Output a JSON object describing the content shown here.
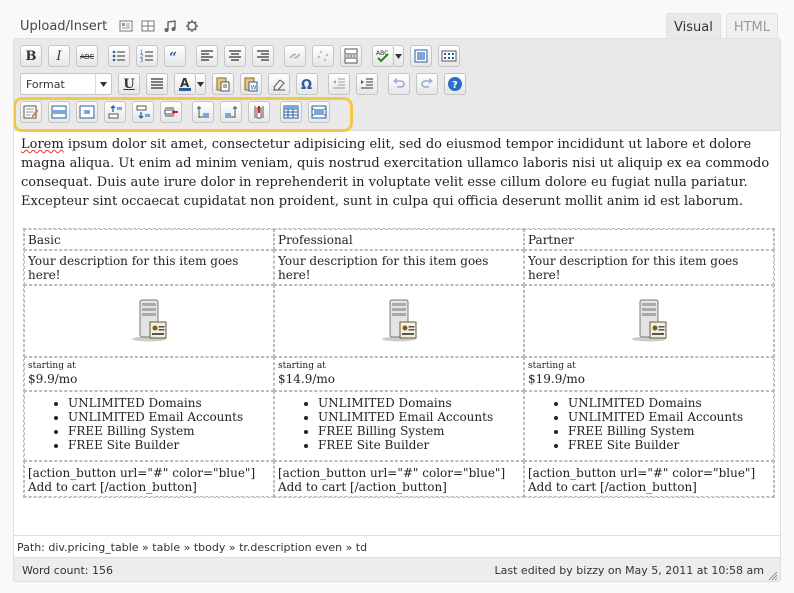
{
  "media": {
    "label": "Upload/Insert",
    "icons": [
      "add-image-icon",
      "add-video-icon",
      "add-audio-icon",
      "add-media-icon"
    ]
  },
  "tabs": {
    "visual": "Visual",
    "html": "HTML"
  },
  "toolbar": {
    "bold": "B",
    "italic": "I",
    "format_value": "Format",
    "underline": "U",
    "text_color": "A",
    "highlight_color": "#f0c94a"
  },
  "content": {
    "paragraph_spell": "Lorem",
    "paragraph": "ipsum dolor sit amet, consectetur adipisicing elit, sed do eiusmod tempor incididunt ut labore et dolore magna aliqua. Ut enim ad minim veniam, quis nostrud exercitation ullamco laboris nisi ut aliquip ex ea commodo consequat. Duis aute irure dolor in reprehenderit in voluptate velit esse cillum dolore eu fugiat nulla pariatur. Excepteur sint occaecat cupidatat non proident, sunt in culpa qui officia deserunt mollit anim id est laborum."
  },
  "pricing": {
    "plans": [
      {
        "name": "Basic",
        "description": "Your description for this item goes here!",
        "price_label": "starting at",
        "price": "$9.9/mo",
        "features": [
          "UNLIMITED Domains",
          "UNLIMITED Email Accounts",
          "FREE Billing System",
          "FREE Site Builder"
        ],
        "button": "[action_button url=\"#\" color=\"blue\"] Add to cart [/action_button]"
      },
      {
        "name": "Professional",
        "description": "Your description for this item goes here!",
        "price_label": "starting at",
        "price": "$14.9/mo",
        "features": [
          "UNLIMITED Domains",
          "UNLIMITED Email Accounts",
          "FREE Billing System",
          "FREE Site Builder"
        ],
        "button": "[action_button url=\"#\" color=\"blue\"] Add to cart [/action_button]"
      },
      {
        "name": "Partner",
        "description": "Your description for this item goes here!",
        "price_label": "starting at",
        "price": "$19.9/mo",
        "features": [
          "UNLIMITED Domains",
          "UNLIMITED Email Accounts",
          "FREE Billing System",
          "FREE Site Builder"
        ],
        "button": "[action_button url=\"#\" color=\"blue\"] Add to cart [/action_button]"
      }
    ]
  },
  "status": {
    "path": "Path: div.pricing_table » table » tbody » tr.description even » td",
    "word_count": "Word count: 156",
    "last_edited": "Last edited by bizzy on May 5, 2011 at 10:58 am"
  }
}
